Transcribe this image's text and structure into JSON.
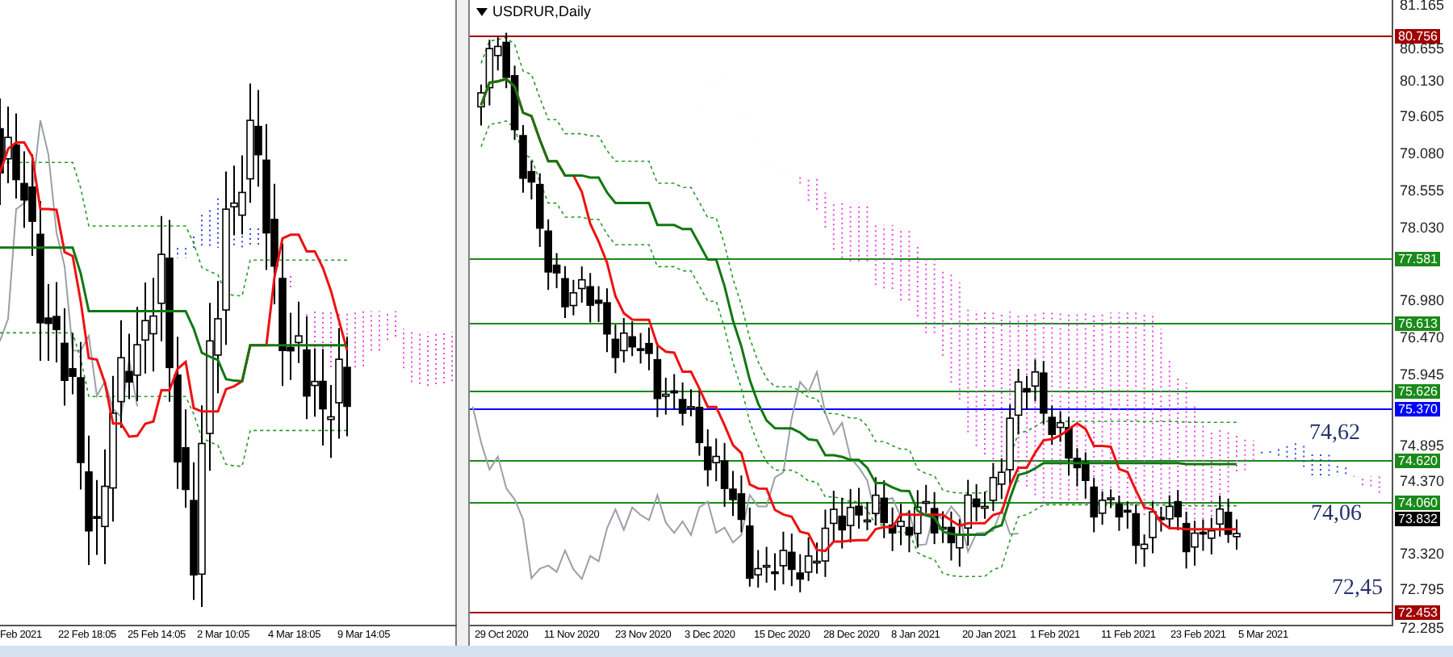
{
  "left_chart": {
    "time_axis": [
      "Feb 2021",
      "22 Feb 18:05",
      "25 Feb 14:05",
      "2 Mar 10:05",
      "4 Mar 18:05",
      "9 Mar 14:05"
    ]
  },
  "right_chart": {
    "title": "USDRUR,Daily",
    "price_axis": [
      "81.165",
      "80.655",
      "80.130",
      "79.605",
      "79.080",
      "78.555",
      "78.030",
      "76.980",
      "76.470",
      "75.945",
      "74.895",
      "74.370",
      "73.320",
      "72.795",
      "72.285"
    ],
    "levels": [
      {
        "label": "80.756",
        "color": "#a00000"
      },
      {
        "label": "77.581",
        "color": "#1a8a1a"
      },
      {
        "label": "76.613",
        "color": "#1a8a1a"
      },
      {
        "label": "75.626",
        "color": "#1a8a1a"
      },
      {
        "label": "75.370",
        "color": "#0000ff"
      },
      {
        "label": "74.620",
        "color": "#1a8a1a"
      },
      {
        "label": "74.060",
        "color": "#1a8a1a"
      },
      {
        "label": "72.453",
        "color": "#a00000"
      }
    ],
    "current_price": "73.832",
    "annotations": [
      "74,62",
      "74,06",
      "72,45"
    ],
    "time_axis": [
      "29 Oct 2020",
      "11 Nov 2020",
      "23 Nov 2020",
      "3 Dec 2020",
      "15 Dec 2020",
      "28 Dec 2020",
      "8 Jan 2021",
      "20 Jan 2021",
      "1 Feb 2021",
      "11 Feb 2021",
      "23 Feb 2021",
      "5 Mar 2021"
    ]
  }
}
